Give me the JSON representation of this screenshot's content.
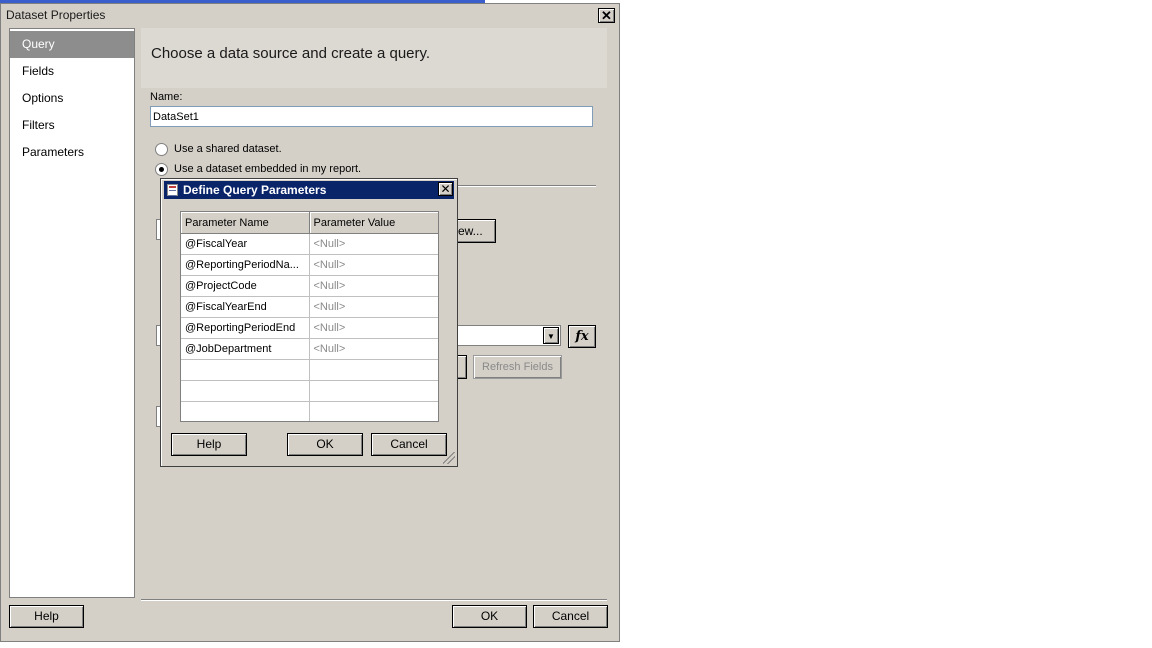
{
  "window": {
    "title": "Dataset Properties",
    "close_glyph": "✕"
  },
  "sidebar": {
    "items": [
      {
        "label": "Query",
        "active": true
      },
      {
        "label": "Fields",
        "active": false
      },
      {
        "label": "Options",
        "active": false
      },
      {
        "label": "Filters",
        "active": false
      },
      {
        "label": "Parameters",
        "active": false
      }
    ]
  },
  "main": {
    "heading": "Choose a data source and create a query.",
    "name_label": "Name:",
    "name_value": "DataSet1",
    "radio_shared_label": "Use a shared dataset.",
    "radio_embedded_label": "Use a dataset embedded in my report.",
    "new_button_label": "ew...",
    "refresh_fields_label": "Refresh Fields",
    "fx_label": "fx",
    "combo_arrow_glyph": "▼"
  },
  "footer": {
    "help_label": "Help",
    "ok_label": "OK",
    "cancel_label": "Cancel"
  },
  "dialog": {
    "title": "Define Query Parameters",
    "close_glyph": "✕",
    "columns": [
      "Parameter Name",
      "Parameter Value"
    ],
    "rows": [
      {
        "name": "@FiscalYear",
        "value": "<Null>"
      },
      {
        "name": "@ReportingPeriodNa...",
        "value": "<Null>"
      },
      {
        "name": "@ProjectCode",
        "value": "<Null>"
      },
      {
        "name": "@FiscalYearEnd",
        "value": "<Null>"
      },
      {
        "name": "@ReportingPeriodEnd",
        "value": "<Null>"
      },
      {
        "name": "@JobDepartment",
        "value": "<Null>"
      },
      {
        "name": "",
        "value": ""
      },
      {
        "name": "",
        "value": ""
      },
      {
        "name": "",
        "value": ""
      }
    ],
    "help_label": "Help",
    "ok_label": "OK",
    "cancel_label": "Cancel"
  }
}
